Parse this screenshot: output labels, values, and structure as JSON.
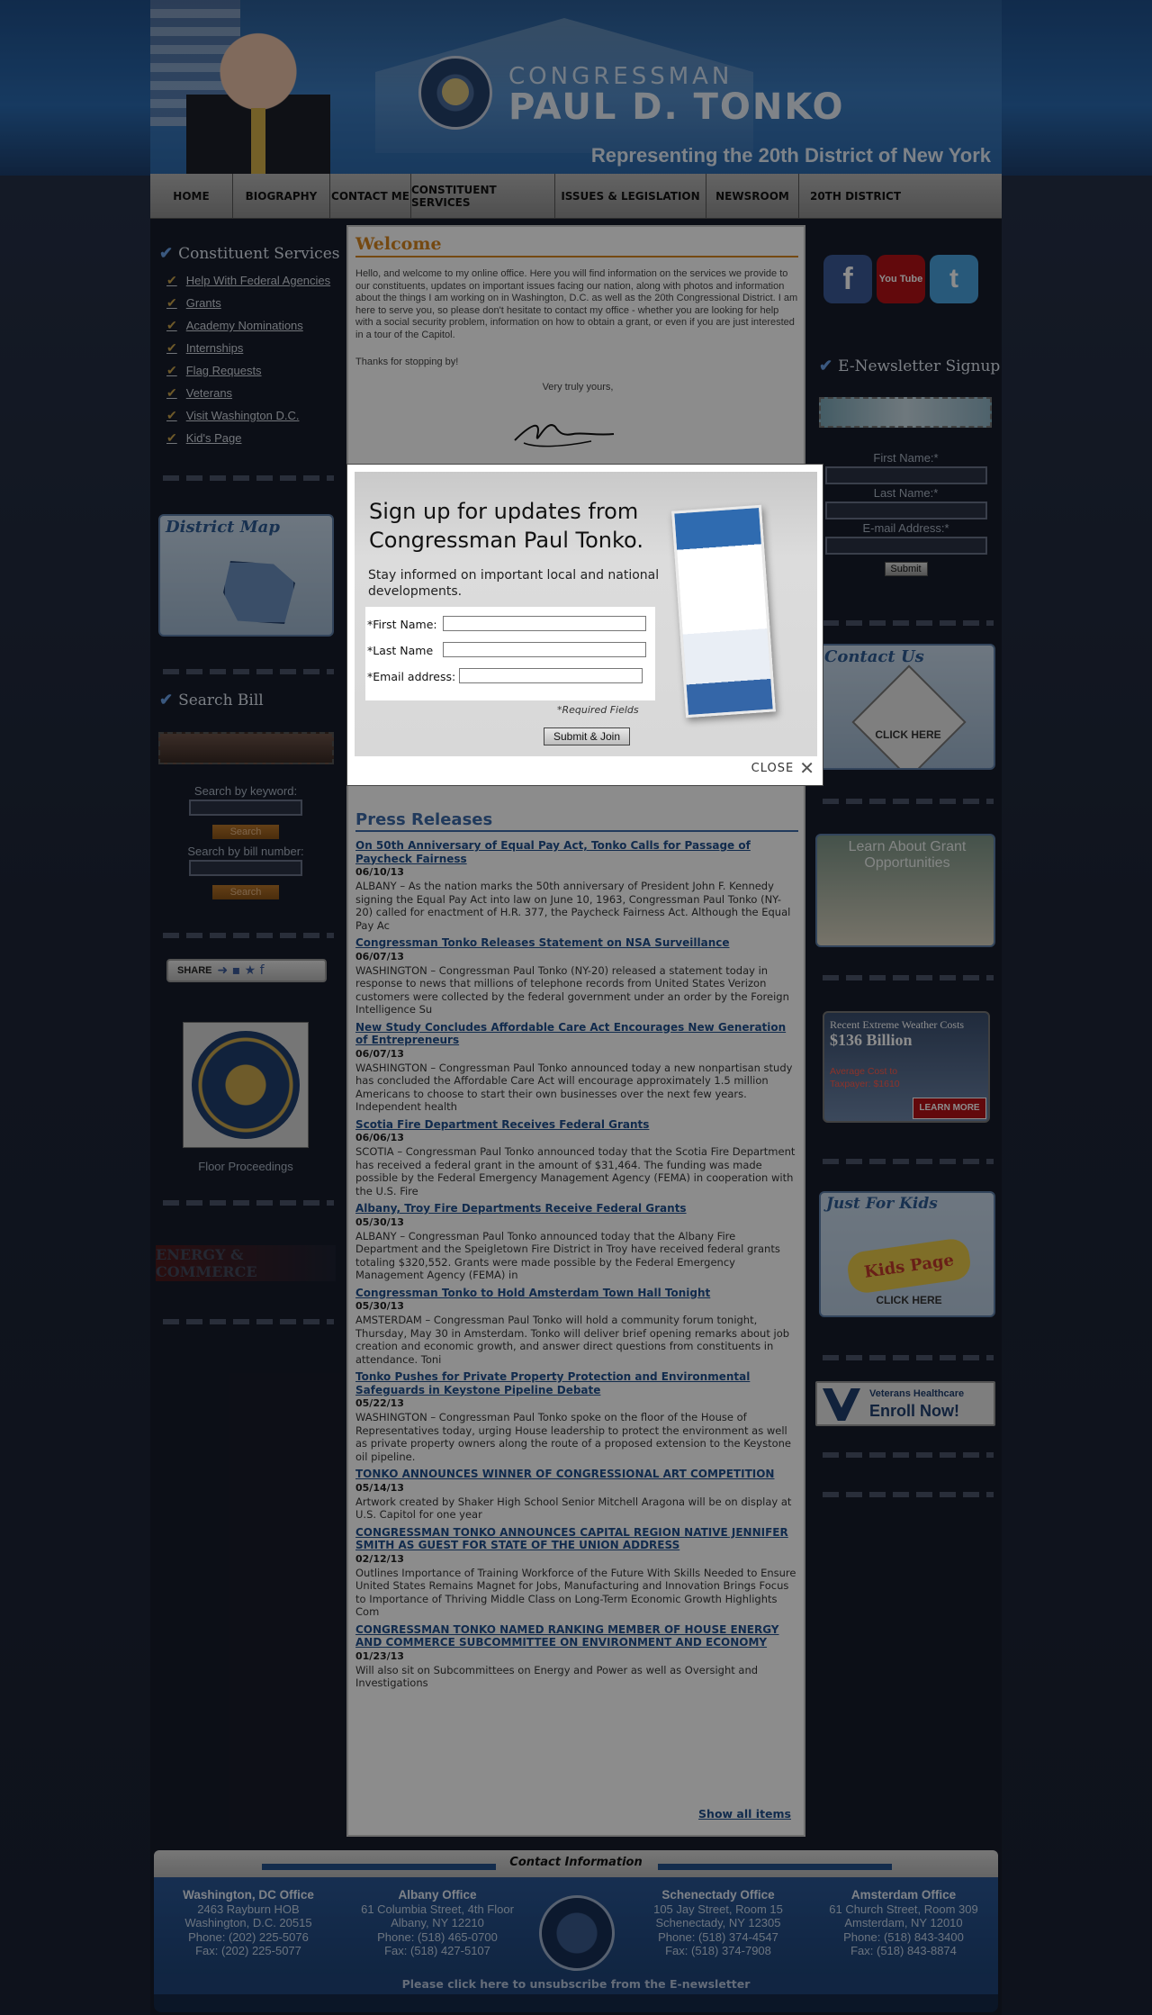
{
  "header": {
    "title_small": "CONGRESSMAN",
    "title_large": "PAUL D. TONKO",
    "tagline": "Representing the 20th District of New York"
  },
  "nav": [
    {
      "label": "HOME"
    },
    {
      "label": "BIOGRAPHY"
    },
    {
      "label": "CONTACT ME"
    },
    {
      "label": "CONSTITUENT SERVICES"
    },
    {
      "label": "ISSUES & LEGISLATION"
    },
    {
      "label": "NEWSROOM"
    },
    {
      "label": "20TH DISTRICT"
    }
  ],
  "left": {
    "constituent_title": "Constituent Services",
    "links": [
      "Help With Federal Agencies",
      "Grants",
      "Academy Nominations",
      "Internships",
      "Flag Requests",
      "Veterans",
      "Visit Washington D.C.",
      "Kid's Page"
    ],
    "district_map_title": "District Map",
    "search_bill_title": "Search Bill",
    "search_keyword_label": "Search by keyword:",
    "search_button": "Search",
    "search_number_label": "Search by bill number:",
    "share_label": "SHARE",
    "floor_label": "Floor Proceedings",
    "energy_label": "ENERGY & COMMERCE"
  },
  "main": {
    "welcome_title": "Welcome",
    "welcome_text": "Hello, and welcome to my online office. Here you will find information on the services we provide to our constituents, updates on important issues facing our nation, along with photos and information about the things I am working on in Washington, D.C. as well as the 20th Congressional District. I am here to serve you, so please don't hesitate to contact my office - whether you are looking for help with a social security problem, information on how to obtain a grant, or even if you are just interested in a tour of the Capitol.",
    "thanks": "Thanks for stopping by!",
    "yours": "Very truly yours,",
    "press_title": "Press Releases",
    "show_all": "Show all items",
    "press": [
      {
        "title": "On 50th Anniversary of Equal Pay Act, Tonko Calls for Passage of Paycheck Fairness",
        "date": "06/10/13",
        "text": "ALBANY – As the nation marks the 50th anniversary of President John F. Kennedy signing the Equal Pay Act into law on June 10, 1963, Congressman Paul Tonko (NY-20) called for enactment of H.R. 377, the Paycheck Fairness Act. Although the Equal Pay Ac"
      },
      {
        "title": "Congressman Tonko Releases Statement on NSA Surveillance",
        "date": "06/07/13",
        "text": "WASHINGTON – Congressman Paul Tonko (NY-20) released a statement today in response to news that millions of telephone records from United States Verizon customers were collected by the federal government under an order by the Foreign Intelligence Su"
      },
      {
        "title": "New Study Concludes Affordable Care Act Encourages New Generation of Entrepreneurs",
        "date": "06/07/13",
        "text": "WASHINGTON – Congressman Paul Tonko announced today a new nonpartisan study has concluded the Affordable Care Act will encourage approximately 1.5 million Americans to choose to start their own businesses over the next few years. Independent health"
      },
      {
        "title": "Scotia Fire Department Receives Federal Grants",
        "date": "06/06/13",
        "text": "SCOTIA – Congressman Paul Tonko announced today that the Scotia Fire Department has received a federal grant in the amount of $31,464. The funding was made possible by the Federal Emergency Management Agency (FEMA) in cooperation with the U.S. Fire"
      },
      {
        "title": "Albany, Troy Fire Departments Receive Federal Grants",
        "date": "05/30/13",
        "text": "ALBANY – Congressman Paul Tonko announced today that the Albany Fire Department and the Speigletown Fire District in Troy have received federal grants totaling $320,552. Grants were made possible by the Federal Emergency Management Agency (FEMA) in"
      },
      {
        "title": "Congressman Tonko to Hold Amsterdam Town Hall Tonight",
        "date": "05/30/13",
        "text": "AMSTERDAM – Congressman Paul Tonko will hold a community forum tonight, Thursday, May 30 in Amsterdam. Tonko will deliver brief opening remarks about job creation and economic growth, and answer direct questions from constituents in attendance. Toni"
      },
      {
        "title": "Tonko Pushes for Private Property Protection and Environmental Safeguards in Keystone Pipeline Debate",
        "date": "05/22/13",
        "text": "WASHINGTON – Congressman Paul Tonko spoke on the floor of the House of Representatives today, urging House leadership to protect the environment as well as private property owners along the route of a proposed extension to the Keystone oil pipeline."
      },
      {
        "title": "TONKO ANNOUNCES WINNER OF CONGRESSIONAL ART COMPETITION",
        "date": "05/14/13",
        "text": "Artwork created by Shaker High School Senior Mitchell Aragona will be on display at U.S. Capitol for one year"
      },
      {
        "title": "CONGRESSMAN TONKO ANNOUNCES CAPITAL REGION NATIVE JENNIFER SMITH AS GUEST FOR STATE OF THE UNION ADDRESS",
        "date": "02/12/13",
        "text": "Outlines Importance of Training Workforce of the Future With Skills Needed to Ensure United States Remains Magnet for Jobs, Manufacturing and Innovation Brings Focus to Importance of Thriving Middle Class on Long-Term Economic Growth Highlights Com"
      },
      {
        "title": "CONGRESSMAN TONKO NAMED RANKING MEMBER OF HOUSE ENERGY AND COMMERCE SUBCOMMITTEE ON ENVIRONMENT AND ECONOMY",
        "date": "01/23/13",
        "text": "Will also sit on Subcommittees on Energy and Power as well as Oversight and Investigations"
      }
    ]
  },
  "right": {
    "social": [
      "facebook-icon",
      "youtube-icon",
      "twitter-icon"
    ],
    "youtube_text": "You Tube",
    "enews_title": "E-Newsletter Signup",
    "first_name_label": "First Name:*",
    "last_name_label": "Last Name:*",
    "email_label": "E-mail Address:*",
    "submit": "Submit",
    "contact_us": "Contact Us",
    "click_here": "CLICK HERE",
    "grant_text": "Learn About Grant Opportunities",
    "weather_title": "Recent Extreme Weather Costs",
    "weather_value": "$136 Billion",
    "weather_sub": "Average Cost to Taxpayer: $1610",
    "learn_more": "LEARN MORE",
    "kids_title": "Just For Kids",
    "kids_page": "Kids Page",
    "va_text": "Veterans Healthcare",
    "va_enroll": "Enroll Now!"
  },
  "footer": {
    "contact_title": "Contact Information",
    "offices": [
      {
        "name": "Washington, DC Office",
        "lines": [
          "2463 Rayburn HOB",
          "Washington, D.C. 20515",
          "Phone: (202) 225-5076",
          "Fax: (202) 225-5077"
        ]
      },
      {
        "name": "Albany Office",
        "lines": [
          "61 Columbia Street, 4th Floor",
          "Albany, NY 12210",
          "Phone: (518) 465-0700",
          "Fax: (518) 427-5107"
        ]
      },
      {
        "name": "Schenectady Office",
        "lines": [
          "105 Jay Street, Room 15",
          "Schenectady, NY 12305",
          "Phone: (518) 374-4547",
          "Fax: (518) 374-7908"
        ]
      },
      {
        "name": "Amsterdam Office",
        "lines": [
          "61 Church Street, Room 309",
          "Amsterdam, NY 12010",
          "Phone: (518) 843-3400",
          "Fax: (518) 843-8874"
        ]
      }
    ],
    "unsubscribe": "Please click here to unsubscribe from the E-newsletter"
  },
  "modal": {
    "title": "Sign up for updates from Congressman Paul Tonko.",
    "subtitle": "Stay informed on important local and national developments.",
    "first_name": "*First Name:",
    "last_name": "*Last Name",
    "email": "*Email address:",
    "required": "*Required Fields",
    "submit": "Submit & Join",
    "close": "CLOSE"
  }
}
